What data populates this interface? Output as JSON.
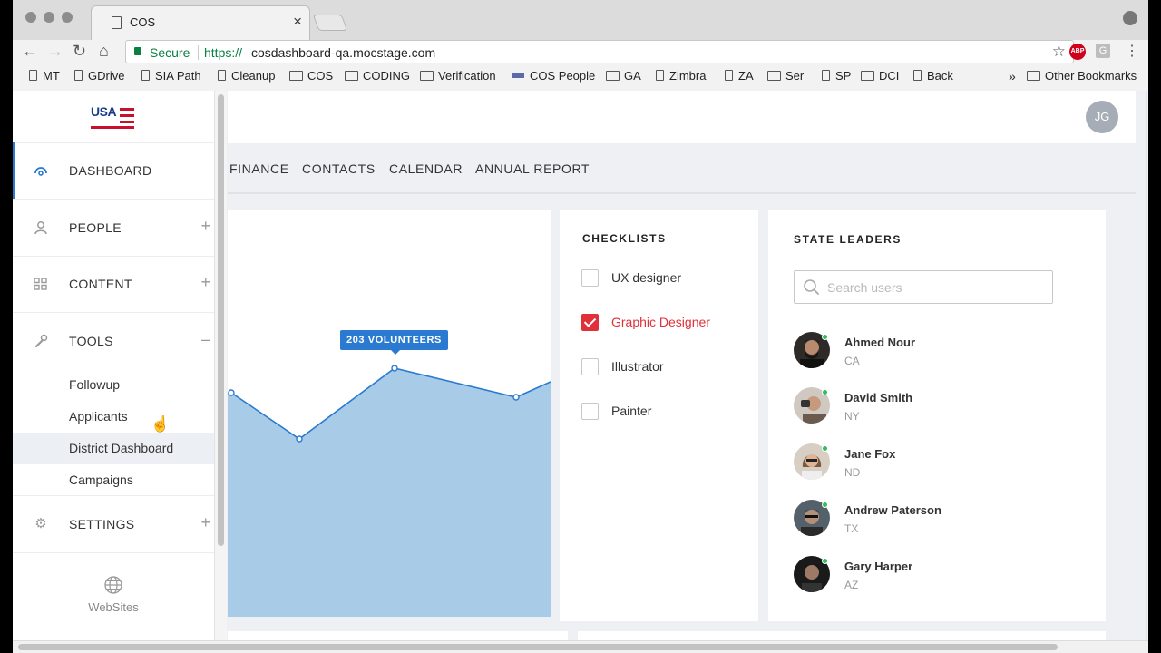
{
  "browser": {
    "tab_title": "COS",
    "secure_label": "Secure",
    "url_protocol": "https://",
    "url_rest": "cosdashboard-qa.mocstage.com",
    "extension_abp": "ABP",
    "extension_g": "G",
    "bookmarks": [
      {
        "label": "MT",
        "icon": "file"
      },
      {
        "label": "GDrive",
        "icon": "file"
      },
      {
        "label": "SIA Path",
        "icon": "file"
      },
      {
        "label": "Cleanup",
        "icon": "file"
      },
      {
        "label": "COS",
        "icon": "folder"
      },
      {
        "label": "CODING",
        "icon": "folder"
      },
      {
        "label": "Verification",
        "icon": "folder"
      },
      {
        "label": "COS People",
        "icon": "flag"
      },
      {
        "label": "GA",
        "icon": "folder"
      },
      {
        "label": "Zimbra",
        "icon": "file"
      },
      {
        "label": "ZA",
        "icon": "file"
      },
      {
        "label": "Ser",
        "icon": "folder"
      },
      {
        "label": "SP",
        "icon": "file"
      },
      {
        "label": "DCI",
        "icon": "folder"
      },
      {
        "label": "Back",
        "icon": "file"
      }
    ],
    "overflow_chevron": "»",
    "other_bookmarks": "Other Bookmarks"
  },
  "sidebar": {
    "logo_text": "USA",
    "items": [
      {
        "label": "DASHBOARD",
        "icon": "dashboard-icon",
        "active": true,
        "toggle": ""
      },
      {
        "label": "PEOPLE",
        "icon": "person-icon",
        "active": false,
        "toggle": "+"
      },
      {
        "label": "CONTENT",
        "icon": "grid-icon",
        "active": false,
        "toggle": "+"
      },
      {
        "label": "TOOLS",
        "icon": "wrench-icon",
        "active": false,
        "toggle": "–"
      }
    ],
    "tools_subitems": [
      "Followup",
      "Applicants",
      "District Dashboard",
      "Campaigns"
    ],
    "settings": {
      "label": "SETTINGS",
      "icon": "gear-icon",
      "toggle": "+"
    },
    "websites_label": "WebSites"
  },
  "header": {
    "avatar_initials": "JG",
    "tabs": [
      "FINANCE",
      "CONTACTS",
      "CALENDAR",
      "ANNUAL REPORT"
    ]
  },
  "volunteers_chart": {
    "tooltip": "203 VOLUNTEERS",
    "fill_color": "#a8cbe8",
    "line_color": "#2a7ad2"
  },
  "checklists": {
    "title": "CHECKLISTS",
    "items": [
      {
        "label": "UX designer",
        "checked": false
      },
      {
        "label": "Graphic Designer",
        "checked": true
      },
      {
        "label": "Illustrator",
        "checked": false
      },
      {
        "label": "Painter",
        "checked": false
      }
    ],
    "accent_color": "#e0303a"
  },
  "state_leaders": {
    "title": "STATE LEADERS",
    "search_placeholder": "Search users",
    "leaders": [
      {
        "name": "Ahmed Nour",
        "state": "CA"
      },
      {
        "name": "David Smith",
        "state": "NY"
      },
      {
        "name": "Jane Fox",
        "state": "ND"
      },
      {
        "name": "Andrew Paterson",
        "state": "TX"
      },
      {
        "name": "Gary Harper",
        "state": "AZ"
      }
    ],
    "online_color": "#2fbf5b"
  }
}
